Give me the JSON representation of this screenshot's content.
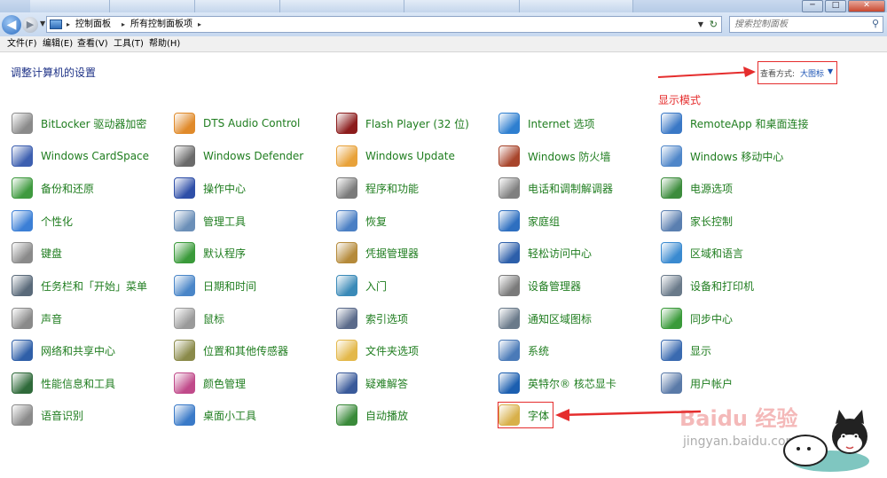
{
  "window": {
    "tabs": [
      "",
      "",
      "",
      "",
      "",
      ""
    ],
    "buttons": {
      "minimize": "─",
      "maximize": "□",
      "close": "✕"
    }
  },
  "address": {
    "breadcrumbs": [
      "控制面板",
      "所有控制面板项"
    ],
    "search_placeholder": "搜索控制面板"
  },
  "menu": [
    "文件(F)",
    "编辑(E)",
    "查看(V)",
    "工具(T)",
    "帮助(H)"
  ],
  "main": {
    "title": "调整计算机的设置",
    "view_by_label": "查看方式:",
    "view_by_value": "大图标",
    "annotation_mode": "显示模式"
  },
  "items": [
    {
      "label": "BitLocker 驱动器加密",
      "icon": "bitlocker-icon",
      "color": "#8a8a8a"
    },
    {
      "label": "DTS Audio Control",
      "icon": "dts-audio-icon",
      "color": "#e08a2a"
    },
    {
      "label": "Flash Player (32 位)",
      "icon": "flash-icon",
      "color": "#8c1c1c"
    },
    {
      "label": "Internet 选项",
      "icon": "internet-options-icon",
      "color": "#2e7fd0"
    },
    {
      "label": "RemoteApp 和桌面连接",
      "icon": "remoteapp-icon",
      "color": "#3a78c6"
    },
    {
      "label": "Windows CardSpace",
      "icon": "cardspace-icon",
      "color": "#3d5fb0"
    },
    {
      "label": "Windows Defender",
      "icon": "defender-icon",
      "color": "#6a6a6a"
    },
    {
      "label": "Windows Update",
      "icon": "windows-update-icon",
      "color": "#e8a23a"
    },
    {
      "label": "Windows 防火墙",
      "icon": "firewall-icon",
      "color": "#a8452c"
    },
    {
      "label": "Windows 移动中心",
      "icon": "mobility-center-icon",
      "color": "#4f86c9"
    },
    {
      "label": "备份和还原",
      "icon": "backup-icon",
      "color": "#3f9a3f"
    },
    {
      "label": "操作中心",
      "icon": "action-center-icon",
      "color": "#2f4fa8"
    },
    {
      "label": "程序和功能",
      "icon": "programs-icon",
      "color": "#7a7a7a"
    },
    {
      "label": "电话和调制解调器",
      "icon": "phone-modem-icon",
      "color": "#808080"
    },
    {
      "label": "电源选项",
      "icon": "power-icon",
      "color": "#3c8c3c"
    },
    {
      "label": "个性化",
      "icon": "personalization-icon",
      "color": "#3b7fd6"
    },
    {
      "label": "管理工具",
      "icon": "admin-tools-icon",
      "color": "#6b8fb8"
    },
    {
      "label": "恢复",
      "icon": "recovery-icon",
      "color": "#4a7fc4"
    },
    {
      "label": "家庭组",
      "icon": "homegroup-icon",
      "color": "#2e6fc0"
    },
    {
      "label": "家长控制",
      "icon": "parental-controls-icon",
      "color": "#5a7fb0"
    },
    {
      "label": "键盘",
      "icon": "keyboard-icon",
      "color": "#8a8a8a"
    },
    {
      "label": "默认程序",
      "icon": "default-programs-icon",
      "color": "#3a9a3a"
    },
    {
      "label": "凭据管理器",
      "icon": "credential-icon",
      "color": "#b58a3a"
    },
    {
      "label": "轻松访问中心",
      "icon": "ease-of-access-icon",
      "color": "#2d5faa"
    },
    {
      "label": "区域和语言",
      "icon": "region-language-icon",
      "color": "#3a8ad0"
    },
    {
      "label": "任务栏和「开始」菜单",
      "icon": "taskbar-icon",
      "color": "#5a6a7a"
    },
    {
      "label": "日期和时间",
      "icon": "datetime-icon",
      "color": "#4a86c8"
    },
    {
      "label": "入门",
      "icon": "getting-started-icon",
      "color": "#3a8ab8"
    },
    {
      "label": "设备管理器",
      "icon": "device-manager-icon",
      "color": "#7a7a7a"
    },
    {
      "label": "设备和打印机",
      "icon": "devices-printers-icon",
      "color": "#6a7a8a"
    },
    {
      "label": "声音",
      "icon": "sound-icon",
      "color": "#8a8a8a"
    },
    {
      "label": "鼠标",
      "icon": "mouse-icon",
      "color": "#9a9a9a"
    },
    {
      "label": "索引选项",
      "icon": "indexing-icon",
      "color": "#5a6a8a"
    },
    {
      "label": "通知区域图标",
      "icon": "notification-area-icon",
      "color": "#6a7a8a"
    },
    {
      "label": "同步中心",
      "icon": "sync-center-icon",
      "color": "#3a9a3a"
    },
    {
      "label": "网络和共享中心",
      "icon": "network-icon",
      "color": "#2f5fa8"
    },
    {
      "label": "位置和其他传感器",
      "icon": "location-sensors-icon",
      "color": "#8a8a4a"
    },
    {
      "label": "文件夹选项",
      "icon": "folder-options-icon",
      "color": "#e3b84a"
    },
    {
      "label": "系统",
      "icon": "system-icon",
      "color": "#4a7ab8"
    },
    {
      "label": "显示",
      "icon": "display-icon",
      "color": "#3a6ab0"
    },
    {
      "label": "性能信息和工具",
      "icon": "performance-icon",
      "color": "#2f6a3a"
    },
    {
      "label": "颜色管理",
      "icon": "color-management-icon",
      "color": "#c04a8a"
    },
    {
      "label": "疑难解答",
      "icon": "troubleshooting-icon",
      "color": "#3a5a9a"
    },
    {
      "label": "英特尔® 核芯显卡",
      "icon": "intel-graphics-icon",
      "color": "#1c5fb0"
    },
    {
      "label": "用户帐户",
      "icon": "user-accounts-icon",
      "color": "#5a7aa8"
    },
    {
      "label": "语音识别",
      "icon": "speech-recognition-icon",
      "color": "#8a8a8a"
    },
    {
      "label": "桌面小工具",
      "icon": "gadgets-icon",
      "color": "#3a7ac8"
    },
    {
      "label": "自动播放",
      "icon": "autoplay-icon",
      "color": "#3a8a3a"
    },
    {
      "label": "字体",
      "icon": "fonts-icon",
      "color": "#d8b04a"
    }
  ],
  "watermark": {
    "brand": "Baidu 经验",
    "url": "jingyan.baidu.com"
  }
}
